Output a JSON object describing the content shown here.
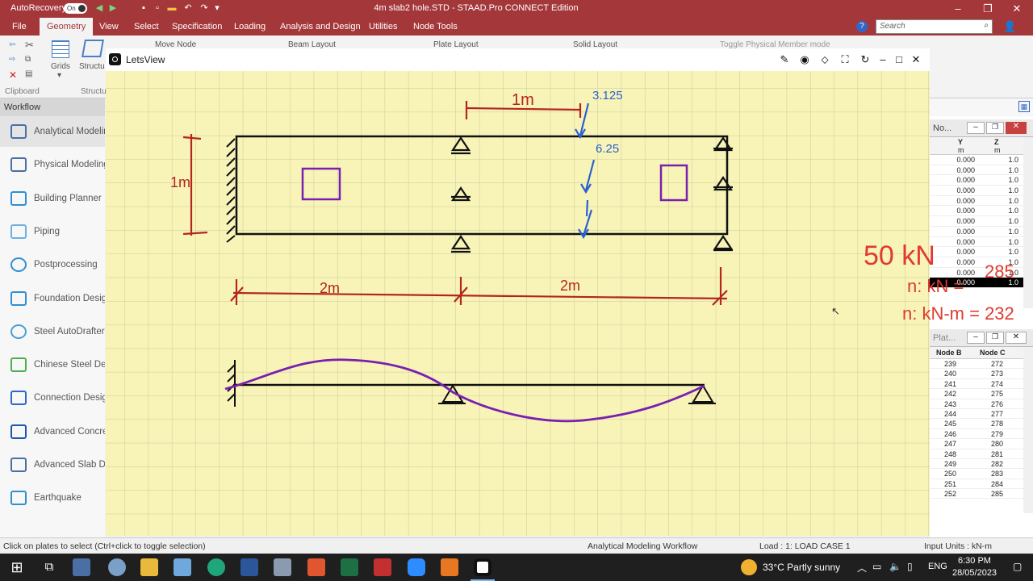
{
  "titlebar": {
    "autorecovery": "AutoRecovery",
    "toggle": "On",
    "title": "4m slab2 hole.STD - STAAD.Pro CONNECT Edition"
  },
  "menu": {
    "items": [
      "File",
      "Geometry",
      "View",
      "Select",
      "Specification",
      "Loading",
      "Analysis and Design",
      "Utilities",
      "Node Tools"
    ],
    "active": "Geometry",
    "search_placeholder": "Search"
  },
  "ribbon": {
    "clipboard": "Clipboard",
    "grids": "Grids",
    "structure_wizard": "Structure Wizard",
    "structure_group": "Structure",
    "move_node": "Move Node",
    "beam_layout": "Beam Layout",
    "plate_layout": "Plate Layout",
    "solid_layout": "Solid Layout",
    "toggle_physical": "Toggle Physical Member mode"
  },
  "workflow": {
    "header": "Workflow",
    "items": [
      {
        "label": "Analytical Modeling",
        "icon": "analytical-icon"
      },
      {
        "label": "Physical Modeling",
        "icon": "physical-icon"
      },
      {
        "label": "Building Planner",
        "icon": "building-icon"
      },
      {
        "label": "Piping",
        "icon": "piping-icon"
      },
      {
        "label": "Postprocessing",
        "icon": "postprocessing-icon"
      },
      {
        "label": "Foundation Design",
        "icon": "foundation-icon"
      },
      {
        "label": "Steel AutoDrafter",
        "icon": "steel-icon"
      },
      {
        "label": "Chinese Steel Design",
        "icon": "chinese-steel-icon"
      },
      {
        "label": "Connection Design",
        "icon": "connection-icon"
      },
      {
        "label": "Advanced Concrete",
        "icon": "concrete-icon"
      },
      {
        "label": "Advanced Slab Design",
        "icon": "slab-icon"
      },
      {
        "label": "Earthquake",
        "icon": "earthquake-icon"
      }
    ]
  },
  "letsview": {
    "title": "LetsView"
  },
  "sketch": {
    "dim_top": "1m",
    "load1": "3.125",
    "load2": "6.25",
    "dim_left": "1m",
    "dim_span1": "2m",
    "dim_span2": "2m",
    "annot1": "50 kN",
    "annot2": "285",
    "annot3": "n: kN =",
    "annot4": "n: kN-m = 232"
  },
  "node_table": {
    "title": "No...",
    "col_y": "Y",
    "col_z": "Z",
    "unit": "m",
    "rows": [
      {
        "y": "0.000",
        "z": "1.0"
      },
      {
        "y": "0.000",
        "z": "1.0"
      },
      {
        "y": "0.000",
        "z": "1.0"
      },
      {
        "y": "0.000",
        "z": "1.0"
      },
      {
        "y": "0.000",
        "z": "1.0"
      },
      {
        "y": "0.000",
        "z": "1.0"
      },
      {
        "y": "0.000",
        "z": "1.0"
      },
      {
        "y": "0.000",
        "z": "1.0"
      },
      {
        "y": "0.000",
        "z": "1.0"
      },
      {
        "y": "0.000",
        "z": "1.0"
      },
      {
        "y": "0.000",
        "z": "1.0"
      },
      {
        "y": "0.000",
        "z": "1.0"
      },
      {
        "y": "0.000",
        "z": "1.0"
      }
    ]
  },
  "plate_table": {
    "title": "Plat...",
    "col_b": "Node B",
    "col_c": "Node C",
    "rows": [
      {
        "b": "239",
        "c": "272"
      },
      {
        "b": "240",
        "c": "273"
      },
      {
        "b": "241",
        "c": "274"
      },
      {
        "b": "242",
        "c": "275"
      },
      {
        "b": "243",
        "c": "276"
      },
      {
        "b": "244",
        "c": "277"
      },
      {
        "b": "245",
        "c": "278"
      },
      {
        "b": "246",
        "c": "279"
      },
      {
        "b": "247",
        "c": "280"
      },
      {
        "b": "248",
        "c": "281"
      },
      {
        "b": "249",
        "c": "282"
      },
      {
        "b": "250",
        "c": "283"
      },
      {
        "b": "251",
        "c": "284"
      },
      {
        "b": "252",
        "c": "285"
      }
    ]
  },
  "status": {
    "hint": "Click on plates to select (Ctrl+click to toggle selection)",
    "workflow": "Analytical Modeling Workflow",
    "load": "Load : 1: LOAD CASE 1",
    "units": "Input Units : kN-m"
  },
  "taskbar": {
    "weather": "33°C  Partly sunny",
    "lang": "ENG",
    "time": "6:30 PM",
    "date": "28/05/2023"
  },
  "colors": {
    "accent": "#a4373a",
    "paper": "#f8f4b8",
    "grid": "#c9c79a",
    "sketch_red": "#b3261e",
    "sketch_blue": "#2a60d0",
    "sketch_purple": "#7a1fb0"
  }
}
